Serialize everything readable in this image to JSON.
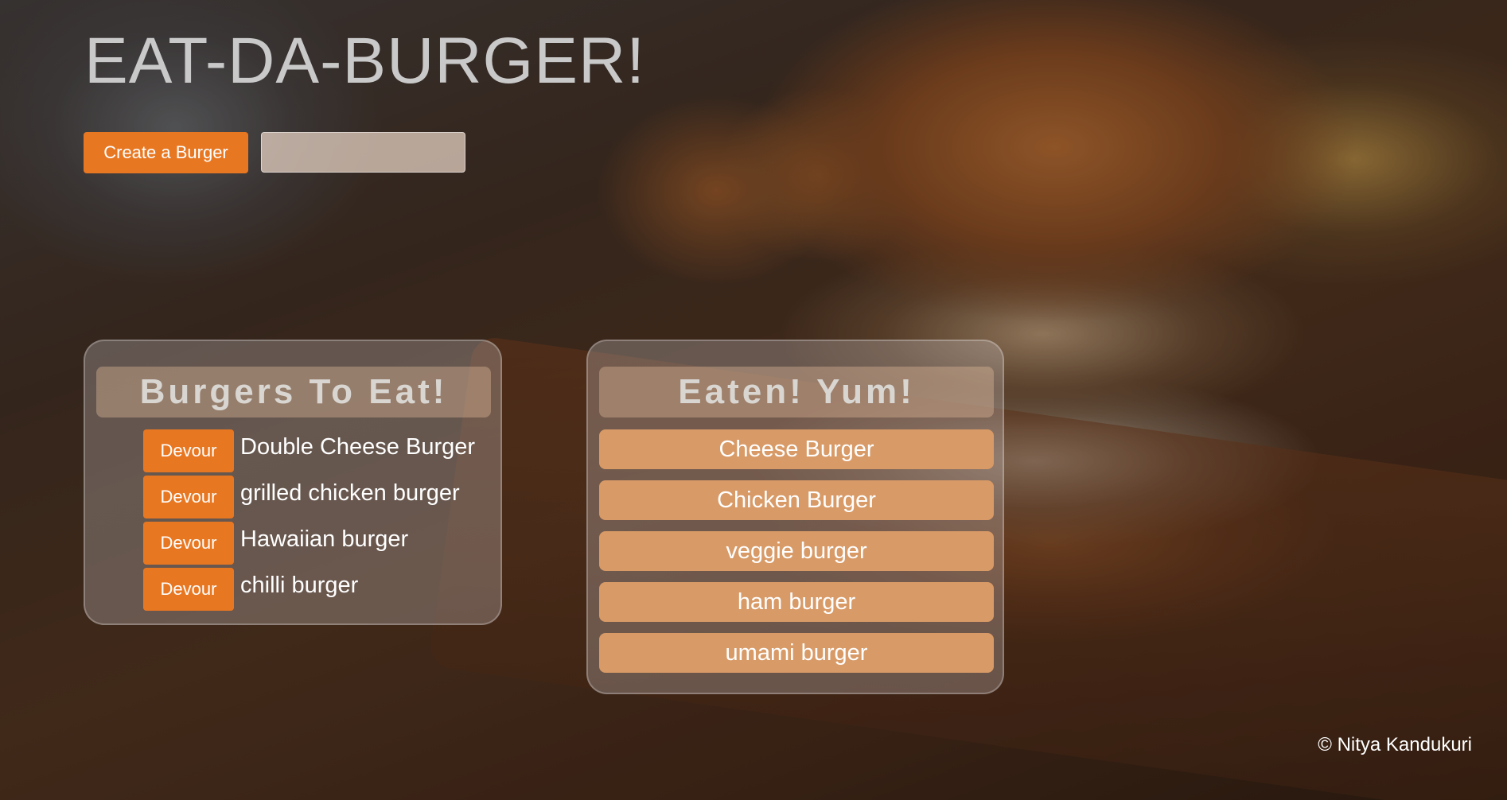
{
  "header": {
    "title": "EAT-DA-BURGER!"
  },
  "form": {
    "create_label": "Create a Burger",
    "input_value": ""
  },
  "to_eat": {
    "heading": "Burgers To Eat!",
    "action_label": "Devour",
    "items": [
      {
        "name": "Double Cheese Burger"
      },
      {
        "name": "grilled chicken burger"
      },
      {
        "name": "Hawaiian burger"
      },
      {
        "name": "chilli burger"
      }
    ]
  },
  "eaten": {
    "heading": "Eaten! Yum!",
    "items": [
      {
        "name": "Cheese Burger"
      },
      {
        "name": "Chicken Burger"
      },
      {
        "name": "veggie burger"
      },
      {
        "name": "ham burger"
      },
      {
        "name": "umami burger"
      }
    ]
  },
  "footer": {
    "copyright": "© Nitya Kandukuri"
  },
  "colors": {
    "accent": "#e87722",
    "eaten_item": "#d89a67",
    "title": "#c9c9c9"
  }
}
